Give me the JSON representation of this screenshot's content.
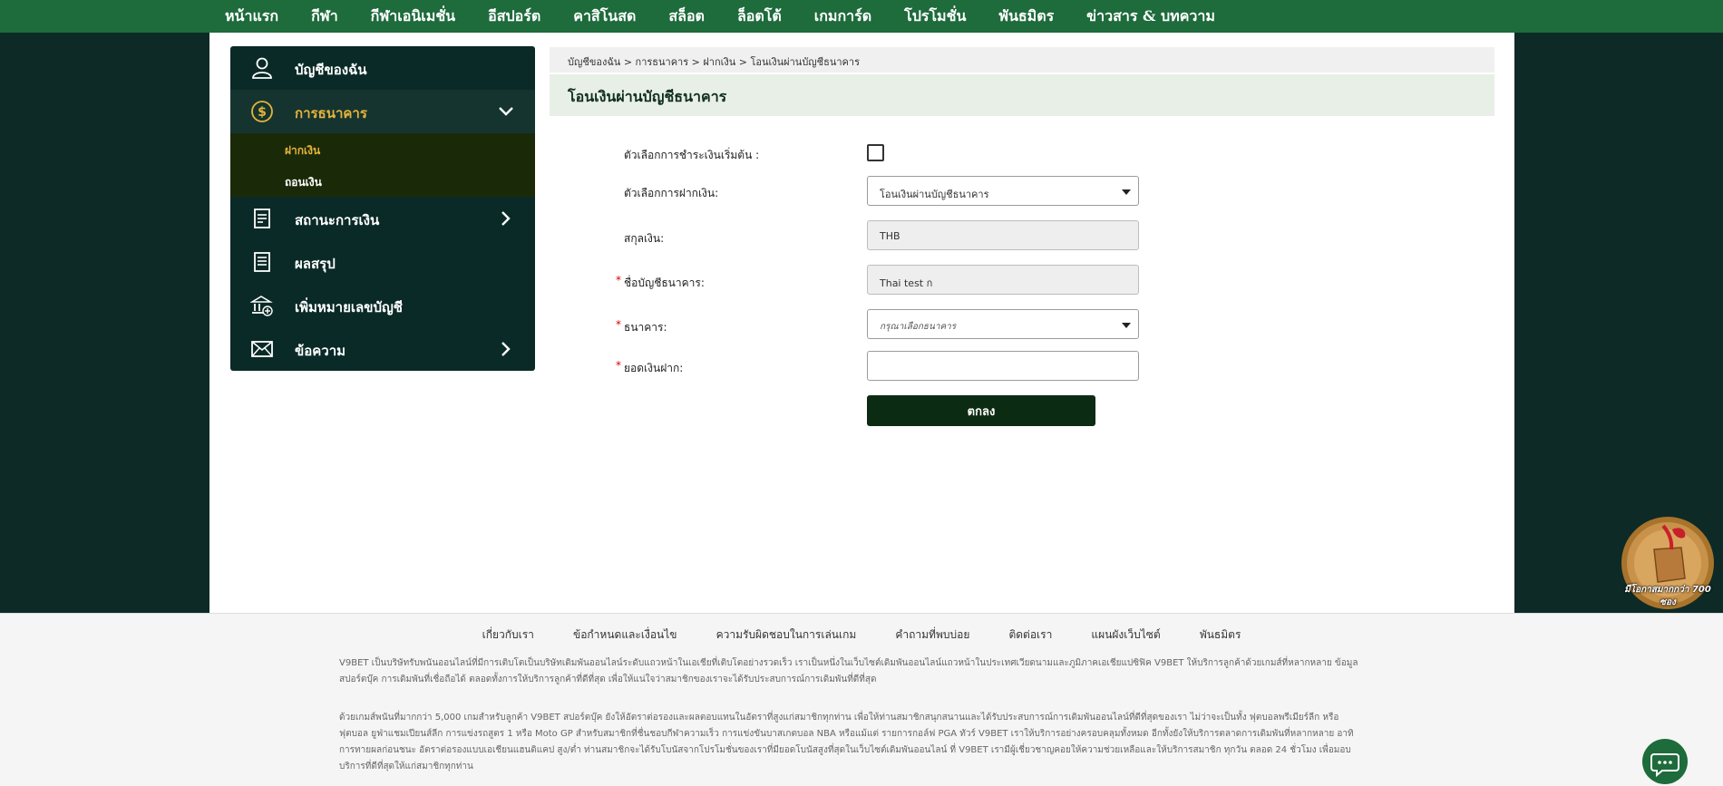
{
  "nav": {
    "items": [
      "หน้าแรก",
      "กีฬา",
      "กีฬาเอนิเมชั่น",
      "อีสปอร์ต",
      "คาสิโนสด",
      "สล็อต",
      "ล็อตโต้",
      "เกมการ์ด",
      "โปรโมชั่น",
      "พันธมิตร",
      "ข่าวสาร & บทความ"
    ]
  },
  "sidebar": {
    "account": "บัญชีของฉัน",
    "banking": "การธนาคาร",
    "deposit": "ฝากเงิน",
    "withdraw": "ถอนเงิน",
    "finance_status": "สถานะการเงิน",
    "summary": "ผลสรุป",
    "add_account": "เพิ่มหมายเลขบัญชี",
    "messages": "ข้อความ"
  },
  "breadcrumb": "บัญชีของฉัน > การธนาคาร > ฝากเงิน > โอนเงินผ่านบัญชีธนาคาร",
  "page_title": "โอนเงินผ่านบัญชีธนาคาร",
  "form": {
    "default_payment_label": "ตัวเลือกการชำระเงินเริ่มต้น :",
    "deposit_option_label": "ตัวเลือกการฝากเงิน:",
    "deposit_option_value": "โอนเงินผ่านบัญชีธนาคาร",
    "currency_label": "สกุลเงิน:",
    "currency_value": "THB",
    "account_name_label": "ชื่อบัญชีธนาคาร:",
    "account_name_value": "Thai test ก",
    "bank_label": "ธนาคาร:",
    "bank_placeholder": "กรุณาเลือกธนาคาร",
    "amount_label": "ยอดเงินฝาก:",
    "amount_value": "",
    "submit": "ตกลง",
    "required_mark": "*"
  },
  "badge": {
    "text": "มีโอกาสมากกว่า 700 ซอง"
  },
  "footer": {
    "links": [
      "เกี่ยวกับเรา",
      "ข้อกำหนดและเงื่อนไข",
      "ความรับผิดชอบในการเล่นเกม",
      "คำถามที่พบบ่อย",
      "ติดต่อเรา",
      "แผนผังเว็บไซต์",
      "พันธมิตร"
    ],
    "para1": "V9BET เป็นบริษัทรับพนันออนไลน์ที่มีการเติบโตเป็นบริษัทเดิมพันออนไลน์ระดับแถวหน้าในเอเชียที่เติบโตอย่างรวดเร็ว เราเป็นหนึ่งในเว็บไซต์เดิมพันออนไลน์แถวหน้าในประเทศเวียดนามและภูมิภาคเอเชียแปซิฟิค V9BET ให้บริการลูกค้าด้วยเกมส์ที่หลากหลาย ข้อมูลสปอร์ตบุ๊ค การเดิมพันที่เชื่อถือได้ ตลอดทั้งการให้บริการลูกค้าที่ดีที่สุด เพื่อให้แน่ใจว่าสมาชิกของเราจะได้รับประสบการณ์การเดิมพันที่ดีที่สุด",
    "para2": "ด้วยเกมส์พนันที่มากกว่า 5,000 เกมสำหรับลูกค้า V9BET สปอร์ตบุ๊ค ยังให้อัตราต่อรองและผลตอบแทนในอัตราที่สูงแก่สมาชิกทุกท่าน เพื่อให้ท่านสมาชิกสนุกสนานและได้รับประสบการณ์การเดิมพันออนไลน์ที่ดีที่สุดของเรา ไม่ว่าจะเป็นทั้ง ฟุตบอลพรีเมียร์ลีก หรือ ฟุตบอล ยูฟ่าแชมเปียนส์ลีก การแข่งรถสูตร 1 หรือ Moto GP สำหรับสมาชิกที่ชื่นชอบกีฬาความเร็ว การแข่งขันบาสเกตบอล NBA หรือแม้แต่ รายการกอล์ฟ PGA ทัวร์ V9BET เราให้บริการอย่างครอบคลุมทั้งหมด อีกทั้งยังให้บริการตลาดการเดิมพันที่หลากหลาย อาทิ การทายผลก่อนชนะ อัตราต่อรองแบบเอเชียนแฮนดิแคป สูง/ต่ำ ท่านสมาชิกจะได้รับโบนัสจากโปรโมชั่นของเราที่มียอดโบนัสสูงที่สุดในเว็บไซต์เดิมพันออนไลน์ ที่ V9BET เรามีผู้เชี่ยวชาญคอยให้ความช่วยเหลือและให้บริการสมาชิก ทุกวัน ตลอด 24 ชั่วโมง เพื่อมอบบริการที่ดีที่สุดให้แก่สมาชิกทุกท่าน"
  },
  "colors": {
    "nav_bg": "#1e6b3c",
    "sidebar_bg": "#0a2a27",
    "active_label": "#e6b43a",
    "submit_bg": "#0c2b13"
  }
}
